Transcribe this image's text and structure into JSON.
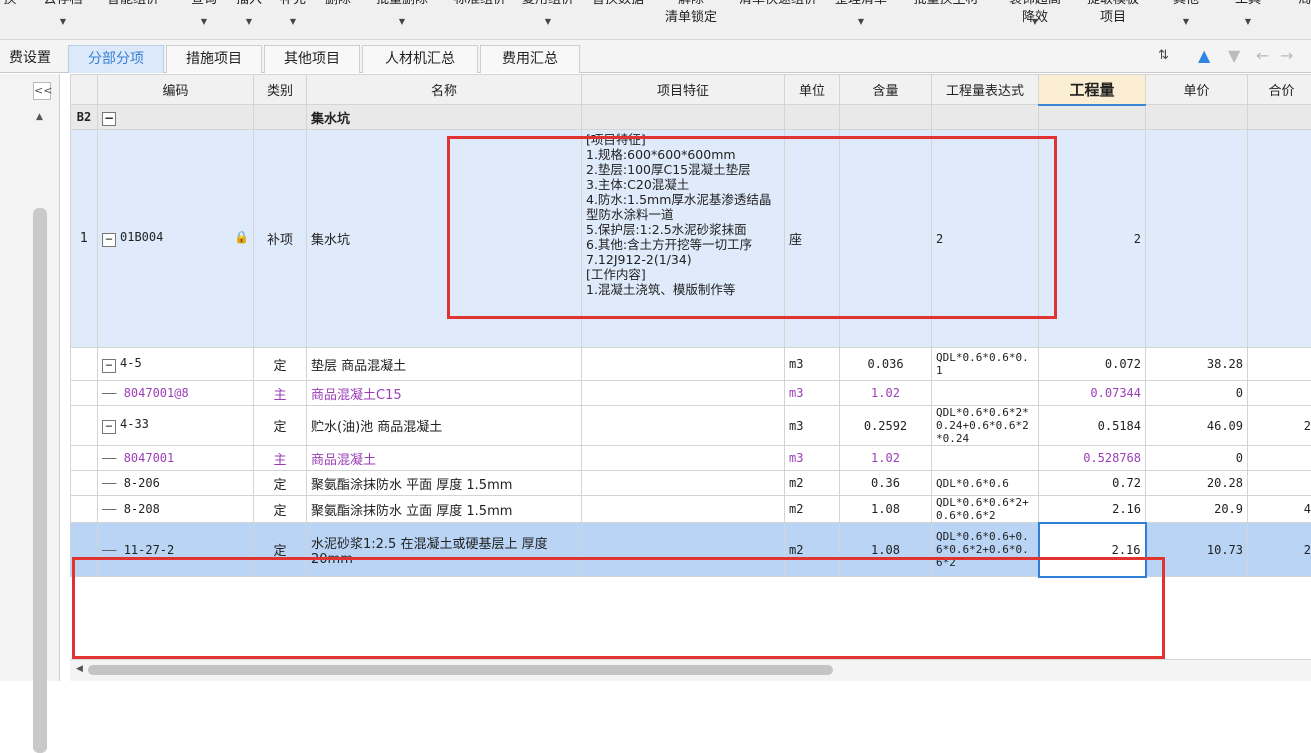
{
  "toolbar": {
    "items": [
      {
        "l1": "换",
        "l2": "",
        "arrow": false
      },
      {
        "l1": "云存档",
        "l2": "",
        "arrow": true
      },
      {
        "l1": "智能组价",
        "l2": "",
        "arrow": false
      },
      {
        "l1": "查询",
        "l2": "",
        "arrow": true
      },
      {
        "l1": "插入",
        "l2": "",
        "arrow": true
      },
      {
        "l1": "补充",
        "l2": "",
        "arrow": true
      },
      {
        "l1": "删除",
        "l2": "",
        "arrow": false
      },
      {
        "l1": "批量删除",
        "l2": "",
        "arrow": true
      },
      {
        "l1": "标准组价",
        "l2": "",
        "arrow": false
      },
      {
        "l1": "复用组价",
        "l2": "",
        "arrow": true
      },
      {
        "l1": "替换数据",
        "l2": "",
        "arrow": false
      },
      {
        "l1": "解除",
        "l2": "清单锁定",
        "arrow": false
      },
      {
        "l1": "清单快速组价",
        "l2": "",
        "arrow": false
      },
      {
        "l1": "整理清单",
        "l2": "",
        "arrow": true
      },
      {
        "l1": "批量换主材",
        "l2": "",
        "arrow": false
      },
      {
        "l1": "装饰超高",
        "l2": "降效",
        "arrow": true
      },
      {
        "l1": "提取模板",
        "l2": "项目",
        "arrow": false
      },
      {
        "l1": "其他",
        "l2": "",
        "arrow": true
      },
      {
        "l1": "工具",
        "l2": "",
        "arrow": true
      },
      {
        "l1": "局",
        "l2": "",
        "arrow": false
      }
    ]
  },
  "tabs": [
    "费设置",
    "分部分项",
    "措施项目",
    "其他项目",
    "人材机汇总",
    "费用汇总"
  ],
  "active_tab": "分部分项",
  "nav_icons": [
    "sort-icon",
    "move-up-icon",
    "move-down-icon",
    "move-left-icon",
    "move-right-icon"
  ],
  "left_panel": {
    "collapse": "<<"
  },
  "grid": {
    "columns": [
      "",
      "编码",
      "类别",
      "名称",
      "项目特征",
      "单位",
      "含量",
      "工程量表达式",
      "工程量",
      "单价",
      "合价"
    ],
    "group": {
      "idx": "B2",
      "toggle": "−",
      "name": "集水坑"
    },
    "item": {
      "idx": "1",
      "toggle": "−",
      "code": "01B004",
      "type": "补项",
      "name": "集水坑",
      "feature": [
        "[项目特征]",
        "1.规格:600*600*600mm",
        "2.垫层:100厚C15混凝土垫层",
        "3.主体:C20混凝土",
        "4.防水:1.5mm厚水泥基渗透结晶型防水涂料一道",
        "5.保护层:1:2.5水泥砂浆抹面",
        "6.其他:含土方开挖等一切工序",
        "7.12J912-2(1/34)",
        "[工作内容]",
        "1.混凝土浇筑、模版制作等"
      ],
      "unit": "座",
      "qty_expr": "2",
      "qty": "2"
    },
    "rows": [
      {
        "code": "4-5",
        "toggle": "−",
        "type": "定",
        "name": "垫层 商品混凝土",
        "unit": "m3",
        "content": "0.036",
        "expr": "QDL*0.6*0.6*0.1",
        "qty": "0.072",
        "price": "38.28",
        "total": "",
        "purple": false
      },
      {
        "code": "8047001@8",
        "toggle": "",
        "type": "主",
        "name": "商品混凝土C15",
        "unit": "m3",
        "content": "1.02",
        "expr": "",
        "qty": "0.07344",
        "price": "0",
        "total": "",
        "purple": true
      },
      {
        "code": "4-33",
        "toggle": "−",
        "type": "定",
        "name": "贮水(油)池 商品混凝土",
        "unit": "m3",
        "content": "0.2592",
        "expr": "QDL*0.6*0.6*2*0.24+0.6*0.6*2*0.24",
        "qty": "0.5184",
        "price": "46.09",
        "total": "2",
        "purple": false
      },
      {
        "code": "8047001",
        "toggle": "",
        "type": "主",
        "name": "商品混凝土",
        "unit": "m3",
        "content": "1.02",
        "expr": "",
        "qty": "0.528768",
        "price": "0",
        "total": "",
        "purple": true
      },
      {
        "code": "8-206",
        "toggle": "",
        "type": "定",
        "name": "聚氨酯涂抹防水 平面 厚度 1.5mm",
        "unit": "m2",
        "content": "0.36",
        "expr": "QDL*0.6*0.6",
        "qty": "0.72",
        "price": "20.28",
        "total": "",
        "purple": false
      },
      {
        "code": "8-208",
        "toggle": "",
        "type": "定",
        "name": "聚氨酯涂抹防水 立面 厚度 1.5mm",
        "unit": "m2",
        "content": "1.08",
        "expr": "QDL*0.6*0.6*2+0.6*0.6*2",
        "qty": "2.16",
        "price": "20.9",
        "total": "4",
        "purple": false
      },
      {
        "code": "11-27-2",
        "toggle": "",
        "type": "定",
        "name": "水泥砂浆1:2.5 在混凝土或硬基层上 厚度 20mm",
        "unit": "m2",
        "content": "1.08",
        "expr": "QDL*0.6*0.6+0.6*0.6*2+0.6*0.6*2",
        "qty": "2.16",
        "price": "10.73",
        "total": "2",
        "purple": false,
        "selected": true
      }
    ]
  }
}
